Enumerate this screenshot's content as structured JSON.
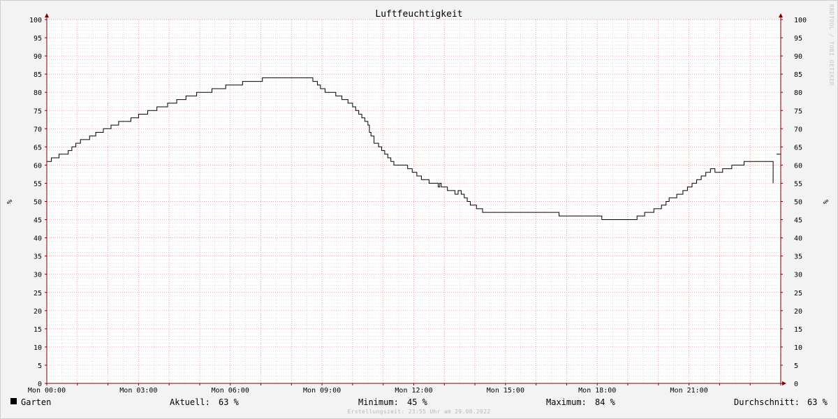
{
  "chart_data": {
    "type": "line",
    "title": "Luftfeuchtigkeit",
    "ylabel": "%",
    "ylim": [
      0,
      100
    ],
    "yticks": [
      0,
      5,
      10,
      15,
      20,
      25,
      30,
      35,
      40,
      45,
      50,
      55,
      60,
      65,
      70,
      75,
      80,
      85,
      90,
      95,
      100
    ],
    "xlim": [
      0,
      24
    ],
    "xticks": [
      {
        "x": 0,
        "label": "Mon 00:00"
      },
      {
        "x": 3,
        "label": "Mon 03:00"
      },
      {
        "x": 6,
        "label": "Mon 06:00"
      },
      {
        "x": 9,
        "label": "Mon 09:00"
      },
      {
        "x": 12,
        "label": "Mon 12:00"
      },
      {
        "x": 15,
        "label": "Mon 15:00"
      },
      {
        "x": 18,
        "label": "Mon 18:00"
      },
      {
        "x": 21,
        "label": "Mon 21:00"
      }
    ],
    "grid": true,
    "legend_position": "bottom",
    "series": [
      {
        "name": "Garten",
        "color": "#000000",
        "step": true,
        "points": [
          [
            0.0,
            61
          ],
          [
            0.15,
            62
          ],
          [
            0.4,
            63
          ],
          [
            0.7,
            64
          ],
          [
            0.82,
            65
          ],
          [
            0.95,
            66
          ],
          [
            1.1,
            67
          ],
          [
            1.4,
            68
          ],
          [
            1.6,
            69
          ],
          [
            1.85,
            70
          ],
          [
            2.1,
            71
          ],
          [
            2.35,
            72
          ],
          [
            2.75,
            73
          ],
          [
            3.0,
            74
          ],
          [
            3.3,
            75
          ],
          [
            3.6,
            76
          ],
          [
            3.95,
            77
          ],
          [
            4.25,
            78
          ],
          [
            4.55,
            79
          ],
          [
            4.9,
            80
          ],
          [
            5.4,
            81
          ],
          [
            5.85,
            82
          ],
          [
            6.4,
            83
          ],
          [
            7.05,
            84
          ],
          [
            8.7,
            83
          ],
          [
            8.85,
            82
          ],
          [
            8.95,
            81
          ],
          [
            9.1,
            80
          ],
          [
            9.45,
            79
          ],
          [
            9.65,
            78
          ],
          [
            9.85,
            77
          ],
          [
            10.0,
            76
          ],
          [
            10.1,
            75
          ],
          [
            10.2,
            74
          ],
          [
            10.3,
            73
          ],
          [
            10.4,
            72
          ],
          [
            10.5,
            71
          ],
          [
            10.55,
            69
          ],
          [
            10.6,
            68
          ],
          [
            10.7,
            66
          ],
          [
            10.85,
            65
          ],
          [
            10.95,
            64
          ],
          [
            11.05,
            63
          ],
          [
            11.15,
            62
          ],
          [
            11.25,
            61
          ],
          [
            11.35,
            60
          ],
          [
            11.8,
            59
          ],
          [
            11.95,
            58
          ],
          [
            12.1,
            57
          ],
          [
            12.25,
            56
          ],
          [
            12.5,
            55
          ],
          [
            12.8,
            54
          ],
          [
            12.85,
            55
          ],
          [
            12.9,
            54
          ],
          [
            13.1,
            53
          ],
          [
            13.35,
            52
          ],
          [
            13.45,
            53
          ],
          [
            13.55,
            52
          ],
          [
            13.65,
            51
          ],
          [
            13.75,
            50
          ],
          [
            13.85,
            49
          ],
          [
            14.05,
            48
          ],
          [
            14.25,
            47
          ],
          [
            16.75,
            46
          ],
          [
            18.15,
            45
          ],
          [
            19.3,
            46
          ],
          [
            19.55,
            47
          ],
          [
            19.85,
            48
          ],
          [
            20.1,
            49
          ],
          [
            20.25,
            50
          ],
          [
            20.35,
            51
          ],
          [
            20.6,
            52
          ],
          [
            20.8,
            53
          ],
          [
            20.95,
            54
          ],
          [
            21.1,
            55
          ],
          [
            21.25,
            56
          ],
          [
            21.4,
            57
          ],
          [
            21.55,
            58
          ],
          [
            21.7,
            59
          ],
          [
            21.85,
            58
          ],
          [
            22.1,
            59
          ],
          [
            22.4,
            60
          ],
          [
            22.8,
            61
          ],
          [
            23.75,
            55
          ]
        ],
        "tail": [
          [
            23.86,
            63
          ],
          [
            24.0,
            63
          ]
        ]
      }
    ]
  },
  "legend": {
    "series_name": "Garten",
    "aktuell_label": "Aktuell:",
    "aktuell_value": "63 %",
    "minimum_label": "Minimum:",
    "minimum_value": "45 %",
    "maximum_label": "Maximum:",
    "maximum_value": "84 %",
    "durchschnitt_label": "Durchschnitt:",
    "durchschnitt_value": "63 %"
  },
  "footer": "Erstellungszeit: 23:55 Uhr am 29.08.2022",
  "watermark": "RRDTOOL / TOBI OETIKER",
  "colors": {
    "background": "#f3f3f3",
    "canvas": "#ffffff",
    "minor_grid": "#c8c8c8",
    "major_grid": "#e08080",
    "axis": "#800000",
    "line": "#000000"
  }
}
